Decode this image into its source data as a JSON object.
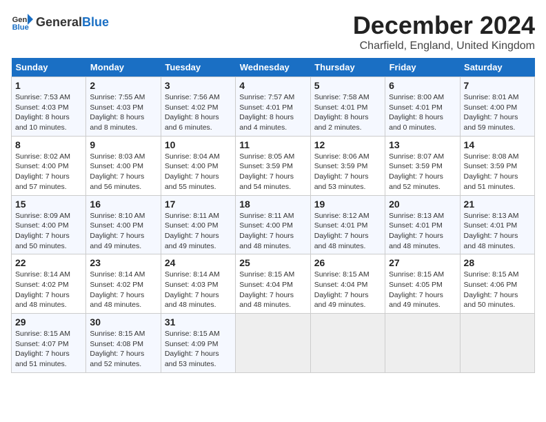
{
  "header": {
    "logo_general": "General",
    "logo_blue": "Blue",
    "title": "December 2024",
    "subtitle": "Charfield, England, United Kingdom"
  },
  "calendar": {
    "days_of_week": [
      "Sunday",
      "Monday",
      "Tuesday",
      "Wednesday",
      "Thursday",
      "Friday",
      "Saturday"
    ],
    "weeks": [
      [
        {
          "day": "1",
          "sunrise": "7:53 AM",
          "sunset": "4:03 PM",
          "daylight": "8 hours and 10 minutes."
        },
        {
          "day": "2",
          "sunrise": "7:55 AM",
          "sunset": "4:03 PM",
          "daylight": "8 hours and 8 minutes."
        },
        {
          "day": "3",
          "sunrise": "7:56 AM",
          "sunset": "4:02 PM",
          "daylight": "8 hours and 6 minutes."
        },
        {
          "day": "4",
          "sunrise": "7:57 AM",
          "sunset": "4:01 PM",
          "daylight": "8 hours and 4 minutes."
        },
        {
          "day": "5",
          "sunrise": "7:58 AM",
          "sunset": "4:01 PM",
          "daylight": "8 hours and 2 minutes."
        },
        {
          "day": "6",
          "sunrise": "8:00 AM",
          "sunset": "4:01 PM",
          "daylight": "8 hours and 0 minutes."
        },
        {
          "day": "7",
          "sunrise": "8:01 AM",
          "sunset": "4:00 PM",
          "daylight": "7 hours and 59 minutes."
        }
      ],
      [
        {
          "day": "8",
          "sunrise": "8:02 AM",
          "sunset": "4:00 PM",
          "daylight": "7 hours and 57 minutes."
        },
        {
          "day": "9",
          "sunrise": "8:03 AM",
          "sunset": "4:00 PM",
          "daylight": "7 hours and 56 minutes."
        },
        {
          "day": "10",
          "sunrise": "8:04 AM",
          "sunset": "4:00 PM",
          "daylight": "7 hours and 55 minutes."
        },
        {
          "day": "11",
          "sunrise": "8:05 AM",
          "sunset": "3:59 PM",
          "daylight": "7 hours and 54 minutes."
        },
        {
          "day": "12",
          "sunrise": "8:06 AM",
          "sunset": "3:59 PM",
          "daylight": "7 hours and 53 minutes."
        },
        {
          "day": "13",
          "sunrise": "8:07 AM",
          "sunset": "3:59 PM",
          "daylight": "7 hours and 52 minutes."
        },
        {
          "day": "14",
          "sunrise": "8:08 AM",
          "sunset": "3:59 PM",
          "daylight": "7 hours and 51 minutes."
        }
      ],
      [
        {
          "day": "15",
          "sunrise": "8:09 AM",
          "sunset": "4:00 PM",
          "daylight": "7 hours and 50 minutes."
        },
        {
          "day": "16",
          "sunrise": "8:10 AM",
          "sunset": "4:00 PM",
          "daylight": "7 hours and 49 minutes."
        },
        {
          "day": "17",
          "sunrise": "8:11 AM",
          "sunset": "4:00 PM",
          "daylight": "7 hours and 49 minutes."
        },
        {
          "day": "18",
          "sunrise": "8:11 AM",
          "sunset": "4:00 PM",
          "daylight": "7 hours and 48 minutes."
        },
        {
          "day": "19",
          "sunrise": "8:12 AM",
          "sunset": "4:01 PM",
          "daylight": "7 hours and 48 minutes."
        },
        {
          "day": "20",
          "sunrise": "8:13 AM",
          "sunset": "4:01 PM",
          "daylight": "7 hours and 48 minutes."
        },
        {
          "day": "21",
          "sunrise": "8:13 AM",
          "sunset": "4:01 PM",
          "daylight": "7 hours and 48 minutes."
        }
      ],
      [
        {
          "day": "22",
          "sunrise": "8:14 AM",
          "sunset": "4:02 PM",
          "daylight": "7 hours and 48 minutes."
        },
        {
          "day": "23",
          "sunrise": "8:14 AM",
          "sunset": "4:02 PM",
          "daylight": "7 hours and 48 minutes."
        },
        {
          "day": "24",
          "sunrise": "8:14 AM",
          "sunset": "4:03 PM",
          "daylight": "7 hours and 48 minutes."
        },
        {
          "day": "25",
          "sunrise": "8:15 AM",
          "sunset": "4:04 PM",
          "daylight": "7 hours and 48 minutes."
        },
        {
          "day": "26",
          "sunrise": "8:15 AM",
          "sunset": "4:04 PM",
          "daylight": "7 hours and 49 minutes."
        },
        {
          "day": "27",
          "sunrise": "8:15 AM",
          "sunset": "4:05 PM",
          "daylight": "7 hours and 49 minutes."
        },
        {
          "day": "28",
          "sunrise": "8:15 AM",
          "sunset": "4:06 PM",
          "daylight": "7 hours and 50 minutes."
        }
      ],
      [
        {
          "day": "29",
          "sunrise": "8:15 AM",
          "sunset": "4:07 PM",
          "daylight": "7 hours and 51 minutes."
        },
        {
          "day": "30",
          "sunrise": "8:15 AM",
          "sunset": "4:08 PM",
          "daylight": "7 hours and 52 minutes."
        },
        {
          "day": "31",
          "sunrise": "8:15 AM",
          "sunset": "4:09 PM",
          "daylight": "7 hours and 53 minutes."
        },
        null,
        null,
        null,
        null
      ]
    ]
  }
}
